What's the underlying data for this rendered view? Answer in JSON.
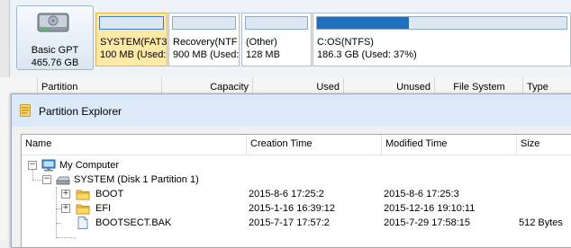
{
  "disk": {
    "name": "Basic GPT",
    "size": "465.76 GB"
  },
  "partitions": [
    {
      "line1": "SYSTEM(FAT32",
      "line2": "100 MB (Used:",
      "used_fraction": 0.0,
      "selected": true
    },
    {
      "line1": "Recovery(NTF",
      "line2": "900 MB (Used:",
      "used_fraction": 0.0,
      "selected": false
    },
    {
      "line1": "(Other)",
      "line2": "128 MB",
      "used_fraction": 0.0,
      "selected": false
    },
    {
      "line1": "C:OS(NTFS)",
      "line2": "186.3 GB (Used: 37%)",
      "used_fraction": 0.37,
      "selected": false
    }
  ],
  "partition_list": {
    "columns": [
      "Partition",
      "Capacity",
      "Used",
      "Unused",
      "File System",
      "Type"
    ]
  },
  "explorer": {
    "title": "Partition Explorer",
    "columns": {
      "name": "Name",
      "creation": "Creation Time",
      "modified": "Modified Time",
      "size": "Size"
    },
    "rows": [
      {
        "name": "My Computer",
        "icon": "computer-icon",
        "expander": "−",
        "creation": "",
        "modified": "",
        "size": ""
      },
      {
        "name": "SYSTEM (Disk 1 Partition 1)",
        "icon": "drive-icon",
        "expander": "−",
        "creation": "",
        "modified": "",
        "size": ""
      },
      {
        "name": "BOOT",
        "icon": "folder-icon",
        "expander": "+",
        "creation": "2015-8-6 17:25:2",
        "modified": "2015-8-6 17:25:3",
        "size": ""
      },
      {
        "name": "EFI",
        "icon": "folder-icon",
        "expander": "+",
        "creation": "2015-1-16 16:39:12",
        "modified": "2015-12-16 19:10:11",
        "size": ""
      },
      {
        "name": "BOOTSECT.BAK",
        "icon": "file-icon",
        "expander": "",
        "creation": "2015-7-17 17:57:2",
        "modified": "2015-7-29 17:58:15",
        "size": "512 Bytes"
      }
    ]
  },
  "colors": {
    "accent": "#1f6fc0",
    "selected_bg": "#fde9a7",
    "title_bar": "#dbe9f9"
  }
}
